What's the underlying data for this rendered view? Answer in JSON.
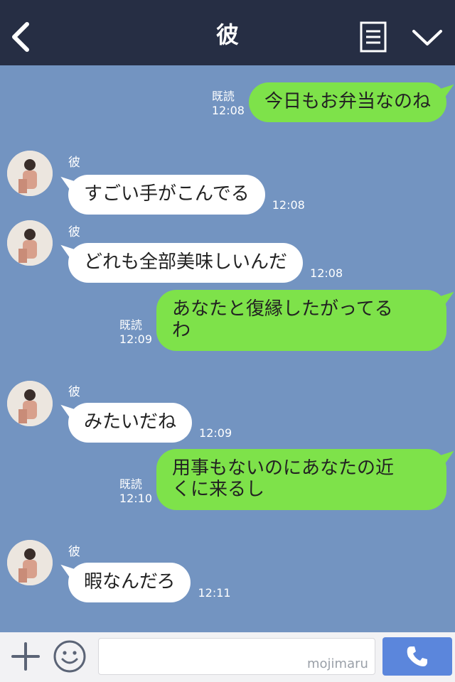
{
  "header": {
    "title": "彼",
    "back_icon": "chevron-left-icon",
    "menu_icon": "document-menu-icon",
    "collapse_icon": "chevron-down-icon"
  },
  "messages": [
    {
      "side": "right",
      "text": "今日もお弁当なのね",
      "read": "既読",
      "time": "12:08"
    },
    {
      "side": "left",
      "sender": "彼",
      "text": "すごい手がこんでる",
      "time": "12:08"
    },
    {
      "side": "left",
      "sender": "彼",
      "text": "どれも全部美味しいんだ",
      "time": "12:08"
    },
    {
      "side": "right",
      "text": "あなたと復縁したがってるわ",
      "line1": "あなたと復縁したがってる",
      "line2": "わ",
      "read": "既読",
      "time": "12:09"
    },
    {
      "side": "left",
      "sender": "彼",
      "text": "みたいだね",
      "time": "12:09"
    },
    {
      "side": "right",
      "text": "用事もないのにあなたの近くに来るし",
      "line1": "用事もないのにあなたの近",
      "line2": "くに来るし",
      "read": "既読",
      "time": "12:10"
    },
    {
      "side": "left",
      "sender": "彼",
      "text": "暇なんだろ",
      "time": "12:11"
    }
  ],
  "input_bar": {
    "plus_icon": "plus-icon",
    "emoji_icon": "smiley-icon",
    "input_value": "",
    "watermark": "mojimaru",
    "call_icon": "phone-icon"
  },
  "colors": {
    "header_bg": "#262e44",
    "chat_bg": "#7394c1",
    "own_bubble": "#7ee24a",
    "other_bubble": "#ffffff",
    "call_button": "#5b86dc"
  }
}
